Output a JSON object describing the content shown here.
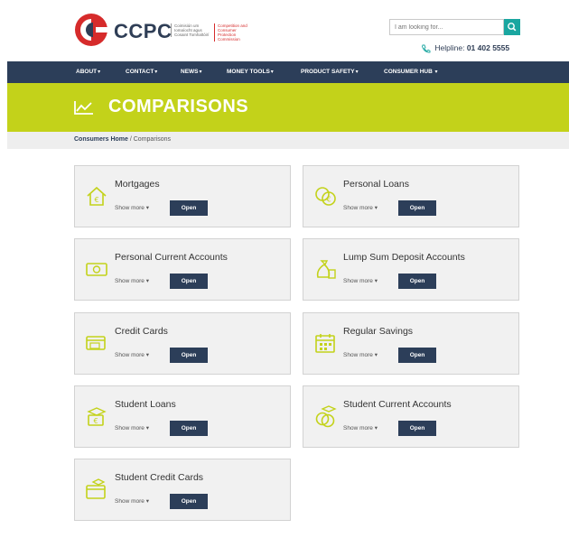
{
  "header": {
    "logo_text": "CCPC",
    "logo_sub_irish": "Coimisiún um Iomaíocht agus Cosaint Tomhaltóirí",
    "logo_sub_english": "Competition and Consumer Protection Commission",
    "search_placeholder": "I am looking for...",
    "helpline_label": "Helpline:",
    "helpline_number": "01 402 5555"
  },
  "nav": {
    "items": [
      {
        "label": "ABOUT"
      },
      {
        "label": "CONTACT"
      },
      {
        "label": "NEWS"
      },
      {
        "label": "MONEY TOOLS"
      },
      {
        "label": "PRODUCT SAFETY"
      },
      {
        "label": "CONSUMER HUB"
      }
    ]
  },
  "banner": {
    "title": "COMPARISONS"
  },
  "breadcrumb": {
    "home": "Consumers Home",
    "separator": " / ",
    "current": "Comparisons"
  },
  "cards": [
    {
      "title": "Mortgages",
      "show_more": "Show more",
      "open": "Open",
      "icon": "house-icon"
    },
    {
      "title": "Personal Loans",
      "show_more": "Show more",
      "open": "Open",
      "icon": "coins-icon"
    },
    {
      "title": "Personal Current Accounts",
      "show_more": "Show more",
      "open": "Open",
      "icon": "banknote-icon"
    },
    {
      "title": "Lump Sum Deposit Accounts",
      "show_more": "Show more",
      "open": "Open",
      "icon": "money-bag-icon"
    },
    {
      "title": "Credit Cards",
      "show_more": "Show more",
      "open": "Open",
      "icon": "credit-card-icon"
    },
    {
      "title": "Regular Savings",
      "show_more": "Show more",
      "open": "Open",
      "icon": "calendar-icon"
    },
    {
      "title": "Student Loans",
      "show_more": "Show more",
      "open": "Open",
      "icon": "student-loan-icon"
    },
    {
      "title": "Student Current Accounts",
      "show_more": "Show more",
      "open": "Open",
      "icon": "student-coins-icon"
    },
    {
      "title": "Student Credit Cards",
      "show_more": "Show more",
      "open": "Open",
      "icon": "student-card-icon"
    }
  ],
  "colors": {
    "navy": "#2c3e59",
    "lime": "#c3d21a",
    "teal": "#1aa6a0",
    "brand_red": "#d62b2b",
    "card_bg": "#f1f1f1"
  }
}
